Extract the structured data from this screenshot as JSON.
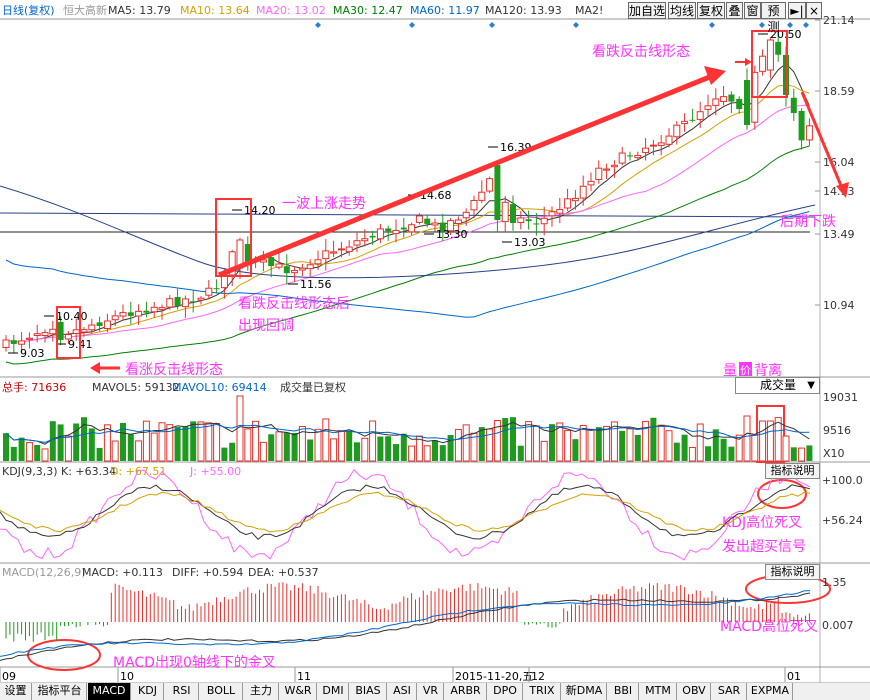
{
  "header": {
    "stock": "日线(复权)",
    "name": "恒大高新",
    "ma": [
      {
        "label": "MA5: 13.79",
        "color": "#333333"
      },
      {
        "label": "MA10: 13.64",
        "color": "#d4a000"
      },
      {
        "label": "MA20: 13.02",
        "color": "#ff66ff"
      },
      {
        "label": "MA30: 12.47",
        "color": "#008000"
      },
      {
        "label": "MA60: 11.97",
        "color": "#0066cc"
      },
      {
        "label": "MA120: 13.93",
        "color": "#333333"
      },
      {
        "label": "MA2!",
        "color": "#333333"
      }
    ],
    "buttons": [
      "加自选",
      "均线",
      "复权",
      "叠",
      "窗",
      "预测"
    ]
  },
  "price_axis": [
    "21.14",
    "18.59",
    "16.04",
    "14.93",
    "13.49",
    "10.94"
  ],
  "annotations": {
    "a1": "看跌反击线形态",
    "a2": "一波上涨走势",
    "a3": "看跌反击线形态后",
    "a4": "出现回调",
    "a5": "看涨反击线形态",
    "a6": "后期下跌",
    "a7": "量价背离",
    "a7_badge": "价",
    "a8": "KDJ高位死叉",
    "a9": "发出超买信号",
    "a10": "MACD高位死叉",
    "a11": "MACD出现0轴线下的金叉"
  },
  "price_labels": [
    "20.50",
    "16.39",
    "14.68",
    "14.20",
    "13.30",
    "13.03",
    "11.56",
    "10.40",
    "9.41",
    "9.03"
  ],
  "volume": {
    "header": [
      {
        "label": "总手: 71636",
        "color": "#cc0000"
      },
      {
        "label": "MAVOL5: 59132",
        "color": "#333333"
      },
      {
        "label": "MAVOL10: 69414",
        "color": "#0066cc"
      },
      {
        "label": "成交量已复权",
        "color": "#333333"
      }
    ],
    "selector": "成交量",
    "axis": [
      "19031",
      "9516",
      "X10"
    ]
  },
  "kdj": {
    "header": [
      {
        "label": "KDJ(9,3,3) K: +63.34",
        "color": "#333333"
      },
      {
        "label": "D: +67.51",
        "color": "#d4a000"
      },
      {
        "label": "J: +55.00",
        "color": "#ff66ff"
      }
    ],
    "button": "指标说明",
    "axis": [
      "+100.0",
      "+56.24"
    ]
  },
  "macd": {
    "header": [
      {
        "label": "MACD(12,26,9)",
        "color": "#999999"
      },
      {
        "label": "MACD: +0.113",
        "color": "#333333"
      },
      {
        "label": "DIFF: +0.594",
        "color": "#333333"
      },
      {
        "label": "DEA: +0.537",
        "color": "#333333"
      }
    ],
    "button": "指标说明",
    "axis": [
      "1.35",
      "0.007"
    ]
  },
  "dates": [
    "09",
    "10",
    "11",
    "2015-11-20,五",
    "12",
    "01"
  ],
  "tabs": [
    "设置",
    "指标平台",
    "MACD",
    "KDJ",
    "RSI",
    "BOLL",
    "主力",
    "W&R",
    "DMI",
    "BIAS",
    "ASI",
    "VR",
    "ARBR",
    "DPO",
    "TRIX",
    "新DMA",
    "BBI",
    "MTM",
    "OBV",
    "SAR",
    "EXPMA"
  ],
  "colors": {
    "up": "#e8302a",
    "down": "#1e9a1e",
    "annotation": "#ff33ff",
    "arrow": "#ff3333"
  }
}
